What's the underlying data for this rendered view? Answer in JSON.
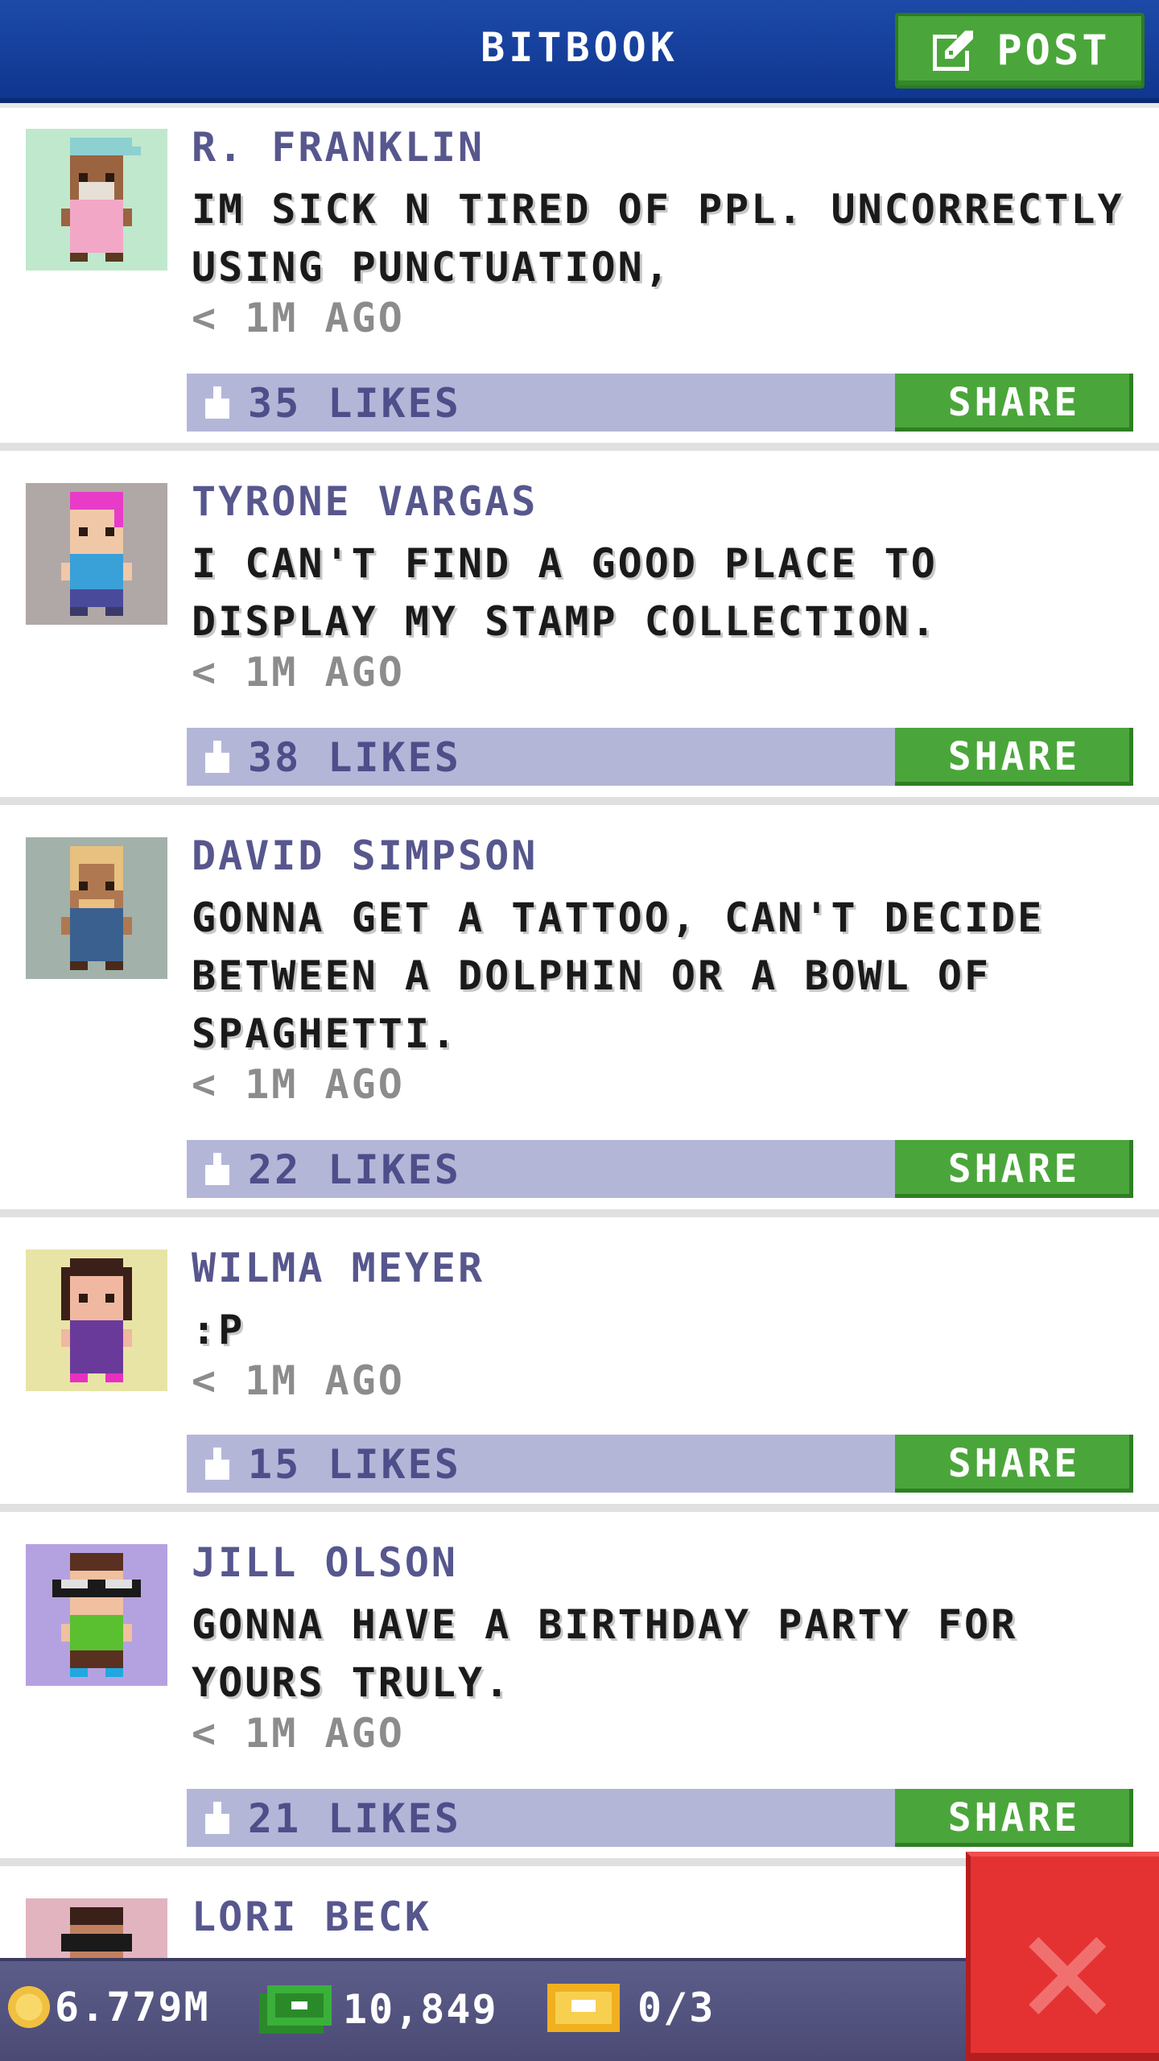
{
  "header": {
    "title": "BITBOOK",
    "post_label": "POST"
  },
  "posts": [
    {
      "author": "R. FRANKLIN",
      "message": "IM SICK N TIRED OF PPL. UNCORRECTLY USING PUNCTUATION,",
      "time": "< 1M AGO",
      "likes": "35 LIKES",
      "share_label": "SHARE",
      "avatar_bg": "#bfe8cc"
    },
    {
      "author": "TYRONE VARGAS",
      "message": "I CAN'T FIND A GOOD PLACE TO DISPLAY MY STAMP COLLECTION.",
      "time": "< 1M AGO",
      "likes": "38 LIKES",
      "share_label": "SHARE",
      "avatar_bg": "#b0a8a6"
    },
    {
      "author": "DAVID SIMPSON",
      "message": "GONNA GET A TATTOO, CAN'T DECIDE BETWEEN A DOLPHIN OR A BOWL OF SPAGHETTI.",
      "time": "< 1M AGO",
      "likes": "22 LIKES",
      "share_label": "SHARE",
      "avatar_bg": "#a2b1aa"
    },
    {
      "author": "WILMA MEYER",
      "message": ":P",
      "time": "< 1M AGO",
      "likes": "15 LIKES",
      "share_label": "SHARE",
      "avatar_bg": "#e8e4a6"
    },
    {
      "author": "JILL OLSON",
      "message": "GONNA HAVE A BIRTHDAY PARTY FOR YOURS TRULY.",
      "time": "< 1M AGO",
      "likes": "21 LIKES",
      "share_label": "SHARE",
      "avatar_bg": "#b4a2e0"
    },
    {
      "author": "LORI BECK",
      "avatar_bg": "#e2b4c0"
    }
  ],
  "status_bar": {
    "coins": "6.779M",
    "bux": "10,849",
    "tickets": "0/3"
  },
  "colors": {
    "header_blue": "#0f3690",
    "share_green": "#4aa63a",
    "like_bar": "#b4b6d8",
    "author_purple": "#57578e",
    "close_red": "#e43232"
  },
  "icons": [
    "edit-icon",
    "thumbs-up-icon",
    "coin-icon",
    "bux-icon",
    "ticket-icon",
    "close-icon"
  ]
}
